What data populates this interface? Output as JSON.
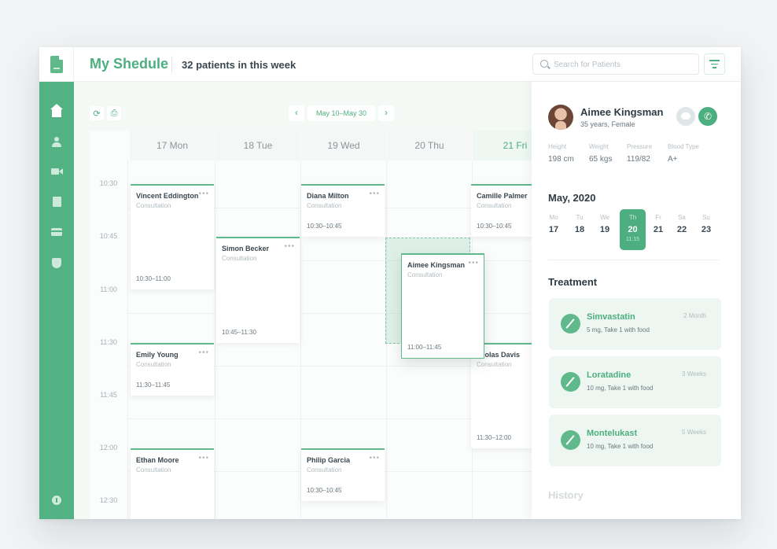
{
  "header": {
    "title": "My Shedule",
    "subtitle": "32 patients in this week",
    "search_placeholder": "Search for Patients"
  },
  "sidebar": {
    "items": [
      {
        "name": "home",
        "active": true
      },
      {
        "name": "patients"
      },
      {
        "name": "video"
      },
      {
        "name": "records"
      },
      {
        "name": "billing"
      },
      {
        "name": "insurance"
      }
    ],
    "bottom": "info"
  },
  "schedule": {
    "toolbar": {
      "refresh_icon": "refresh-icon",
      "print_icon": "print-icon"
    },
    "date_range": "May 10–May 30",
    "prev_label": "‹",
    "next_label": "›",
    "days": [
      "17 Mon",
      "18 Tue",
      "19 Wed",
      "20 Thu",
      "21 Fri"
    ],
    "active_day": "21 Fri",
    "times": [
      "10:30",
      "10:45",
      "11:00",
      "11:30",
      "11:45",
      "12:00",
      "12:30"
    ],
    "appointments": [
      {
        "name": "Vincent Eddington",
        "type": "Consultation",
        "time": "10:30–11:00",
        "day": "17 Mon"
      },
      {
        "name": "Emily Young",
        "type": "Consultation",
        "time": "11:30–11:45",
        "day": "17 Mon"
      },
      {
        "name": "Ethan Moore",
        "type": "Consultation",
        "time": "",
        "day": "17 Mon"
      },
      {
        "name": "Simon Becker",
        "type": "Consultation",
        "time": "10:45–11:30",
        "day": "18 Tue"
      },
      {
        "name": "Diana Milton",
        "type": "Consultation",
        "time": "10:30–10:45",
        "day": "19 Wed"
      },
      {
        "name": "Philip Garcia",
        "type": "Consultation",
        "time": "10:30–10:45",
        "day": "19 Wed"
      },
      {
        "name": "Aimee Kingsman",
        "type": "Consultation",
        "time": "11:00–11:45",
        "day": "20 Thu"
      },
      {
        "name": "Camille Palmer",
        "type": "Consultation",
        "time": "10:30–10:45",
        "day": "21 Fri"
      },
      {
        "name": "cholas Davis",
        "type": "Consultation",
        "time": "11:30–12:00",
        "day": "21 Fri"
      }
    ],
    "dots": "•••"
  },
  "patient": {
    "name": "Aimee Kingsman",
    "subtitle": "35 years, Female",
    "stats": [
      {
        "label": "Height",
        "value": "198 cm"
      },
      {
        "label": "Weight",
        "value": "65 kgs"
      },
      {
        "label": "Pressure",
        "value": "119/82"
      },
      {
        "label": "Blood Type",
        "value": "A+"
      }
    ],
    "call_icon": "phone-icon",
    "chat_icon": "chat-icon"
  },
  "calendar": {
    "month": "May, 2020",
    "days": [
      {
        "dn": "Mo",
        "dd": "17"
      },
      {
        "dn": "Tu",
        "dd": "18"
      },
      {
        "dn": "We",
        "dd": "19"
      },
      {
        "dn": "Th",
        "dd": "20",
        "time": "11:15",
        "selected": true
      },
      {
        "dn": "Fr",
        "dd": "21"
      },
      {
        "dn": "Sa",
        "dd": "22"
      },
      {
        "dn": "Su",
        "dd": "23"
      }
    ]
  },
  "treatment": {
    "title": "Treatment",
    "meds": [
      {
        "name": "Simvastatin",
        "dose": "5 mg, Take 1 with food",
        "duration": "2 Month"
      },
      {
        "name": "Loratadine",
        "dose": "10 mg, Take 1 with food",
        "duration": "3 Weeks"
      },
      {
        "name": "Montelukast",
        "dose": "10 mg, Take 1 with food",
        "duration": "5 Weeks"
      }
    ]
  },
  "history": {
    "title": "History"
  },
  "colors": {
    "accent": "#4dae7f",
    "sidebar": "#52b284",
    "card_bg": "#eef6f1"
  }
}
